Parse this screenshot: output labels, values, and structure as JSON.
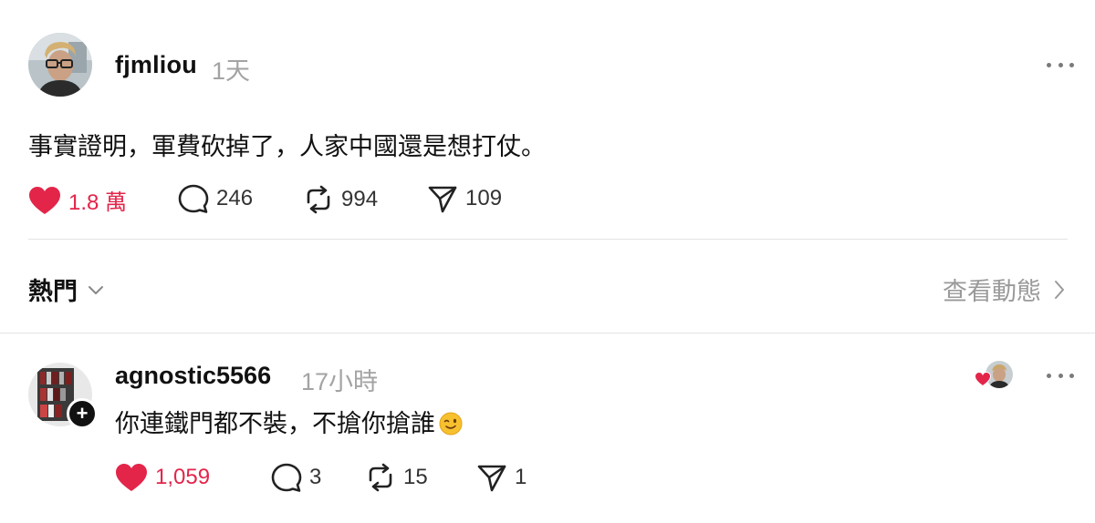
{
  "post": {
    "username": "fjmliou",
    "time": "1天",
    "text": "事實證明，軍費砍掉了，人家中國還是想打仗。",
    "like_count": "1.8 萬",
    "comment_count": "246",
    "repost_count": "994",
    "share_count": "109",
    "liked": true
  },
  "sort": {
    "label": "熱門",
    "view_activity_label": "查看動態"
  },
  "reply": {
    "username": "agnostic5566",
    "time": "17小時",
    "text": "你連鐵門都不裝，不搶你搶誰",
    "emoji": "winking-face",
    "like_count": "1,059",
    "comment_count": "3",
    "repost_count": "15",
    "share_count": "1",
    "liked": true,
    "liked_by_author": true
  },
  "colors": {
    "like_red": "#e3254a",
    "muted_gray": "#a3a3a3",
    "divider": "#e3e3e3"
  },
  "icons": [
    "ellipsis-icon",
    "heart-icon",
    "comment-icon",
    "repost-icon",
    "share-icon",
    "chevron-down-icon",
    "chevron-right-icon",
    "plus-icon"
  ]
}
